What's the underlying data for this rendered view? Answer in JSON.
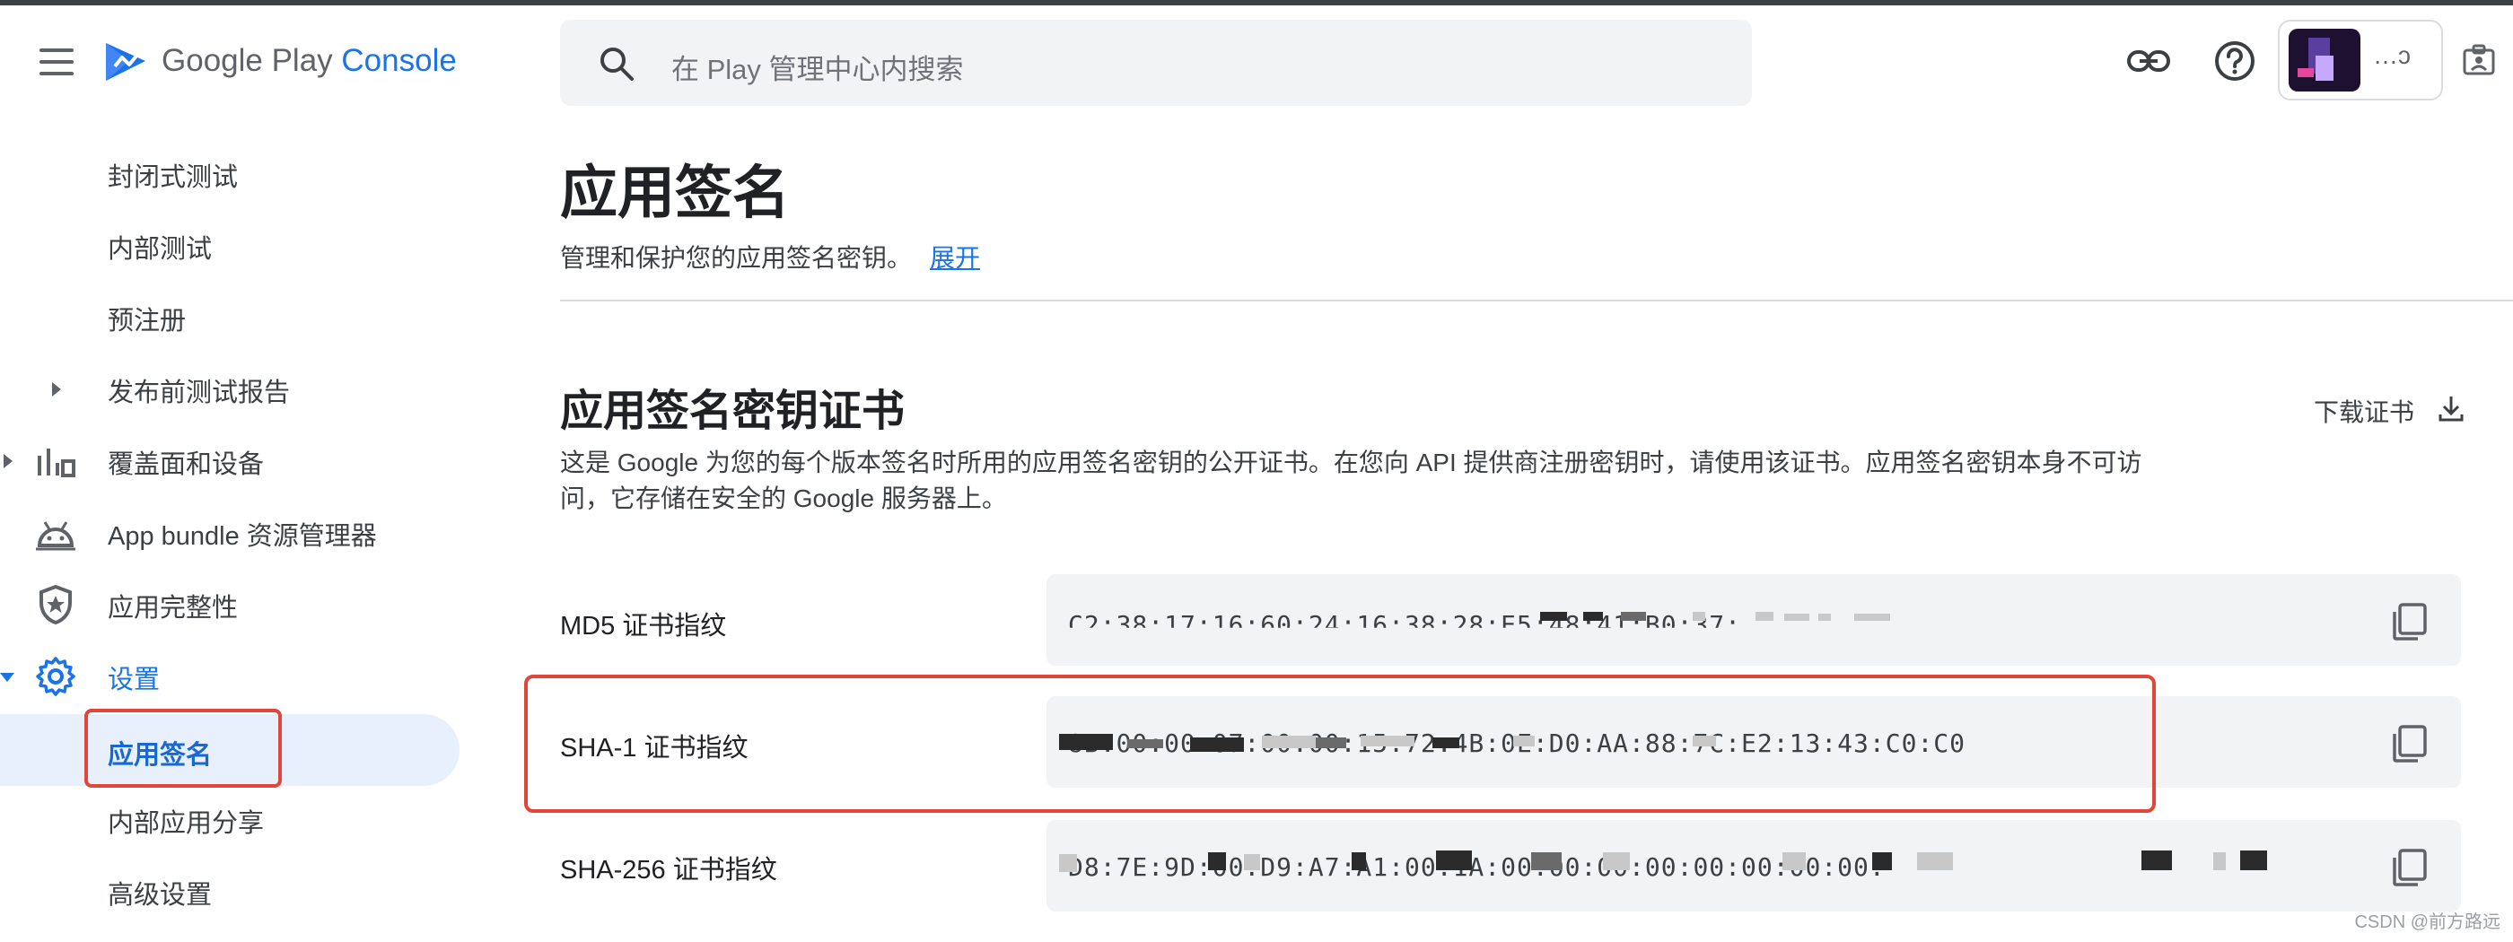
{
  "header": {
    "logo_google_play": "Google Play ",
    "logo_console": "Console",
    "search_placeholder": "在 Play 管理中心内搜索"
  },
  "sidebar": {
    "items": [
      {
        "label": "封闭式测试"
      },
      {
        "label": "内部测试"
      },
      {
        "label": "预注册"
      },
      {
        "label": "发布前测试报告"
      },
      {
        "label": "覆盖面和设备"
      },
      {
        "label": "App bundle 资源管理器"
      },
      {
        "label": "应用完整性"
      },
      {
        "label": "设置"
      },
      {
        "label": "应用签名"
      },
      {
        "label": "内部应用分享"
      },
      {
        "label": "高级设置"
      }
    ]
  },
  "page": {
    "title": "应用签名",
    "subtitle": "管理和保护您的应用签名密钥。",
    "expand_link": "展开"
  },
  "section": {
    "title": "应用签名密钥证书",
    "download_label": "下载证书",
    "description": "这是 Google 为您的每个版本签名时所用的应用签名密钥的公开证书。在您向 API 提供商注册密钥时，请使用该证书。应用签名密钥本身不可访问，它存储在安全的 Google 服务器上。",
    "fingerprints": [
      {
        "label": "MD5 证书指纹",
        "value": "C2:38:17:16:60:24:16:38:28:E5:48:41:B0:37:"
      },
      {
        "label": "SHA-1 证书指纹",
        "value": "8B:00:00:07:00:00:15:72:4B:0E:D0:AA:88:7C:E2:13:43:C0:C0"
      },
      {
        "label": "SHA-256 证书指纹",
        "value": "D8:7E:9D:00:D9:A7:A1:00:1A:00:00:00:00:00:00:00:00:"
      }
    ]
  },
  "watermark": "CSDN @前方路远",
  "colors": {
    "accent": "#1a73e8",
    "active_nav_bg": "#e8f0fe",
    "highlight_red": "#e2463a",
    "field_bg": "#f1f3f4"
  },
  "icons": [
    "menu-icon",
    "play-console-logo",
    "search-icon",
    "link-icon",
    "help-icon",
    "account-switch-icon",
    "stats-icon",
    "android-icon",
    "shield-icon",
    "gear-icon",
    "download-icon",
    "copy-icon"
  ]
}
